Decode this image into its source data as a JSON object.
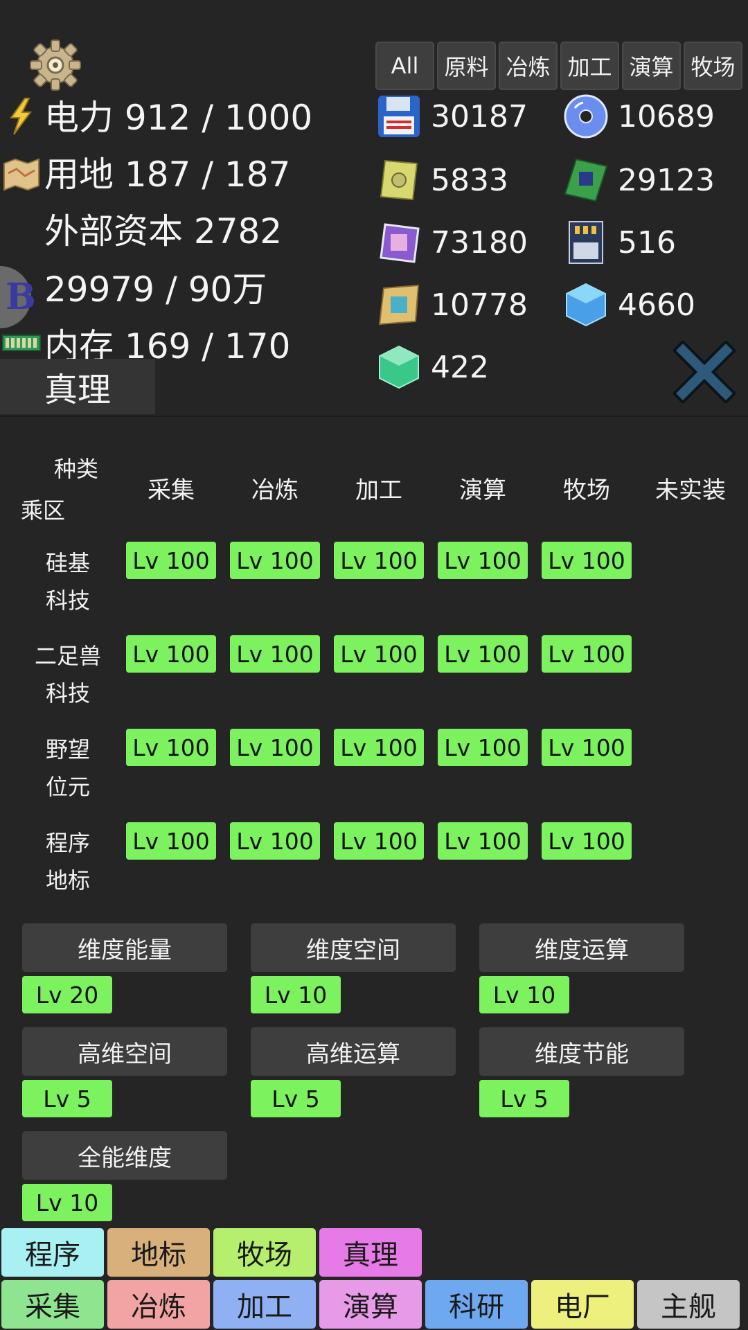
{
  "header": {
    "stats": {
      "power": "电力 912 / 1000",
      "land": "用地 187 / 187",
      "capital": "外部资本 2782",
      "b_currency": "29979 / 90万",
      "memory": "内存 169 / 170"
    },
    "filter_tabs": [
      "All",
      "原料",
      "冶炼",
      "加工",
      "演算",
      "牧场"
    ]
  },
  "resources": [
    "30187",
    "10689",
    "5833",
    "29123",
    "73180",
    "516",
    "10778",
    "4660",
    "422"
  ],
  "active_panel": "真理",
  "grid": {
    "corner_top": "种类",
    "corner_bottom": "乘区",
    "columns": [
      "采集",
      "冶炼",
      "加工",
      "演算",
      "牧场",
      "未实装"
    ],
    "rows": [
      {
        "line1": "硅基",
        "line2": "科技",
        "levels": [
          "Lv 100",
          "Lv 100",
          "Lv 100",
          "Lv 100",
          "Lv 100"
        ]
      },
      {
        "line1": "二足兽",
        "line2": "科技",
        "levels": [
          "Lv 100",
          "Lv 100",
          "Lv 100",
          "Lv 100",
          "Lv 100"
        ]
      },
      {
        "line1": "野望",
        "line2": "位元",
        "levels": [
          "Lv 100",
          "Lv 100",
          "Lv 100",
          "Lv 100",
          "Lv 100"
        ]
      },
      {
        "line1": "程序",
        "line2": "地标",
        "levels": [
          "Lv 100",
          "Lv 100",
          "Lv 100",
          "Lv 100",
          "Lv 100"
        ]
      }
    ]
  },
  "dimensions": [
    {
      "name": "维度能量",
      "level": "Lv 20"
    },
    {
      "name": "维度空间",
      "level": "Lv 10"
    },
    {
      "name": "维度运算",
      "level": "Lv 10"
    },
    {
      "name": "高维空间",
      "level": "Lv 5"
    },
    {
      "name": "高维运算",
      "level": "Lv 5"
    },
    {
      "name": "维度节能",
      "level": "Lv 5"
    },
    {
      "name": "全能维度",
      "level": "Lv 10"
    }
  ],
  "nav_row1": [
    {
      "label": "程序",
      "color": "#a8f0f2"
    },
    {
      "label": "地标",
      "color": "#d7b07c"
    },
    {
      "label": "牧场",
      "color": "#b6ee6e"
    },
    {
      "label": "真理",
      "color": "#e67ae6"
    }
  ],
  "nav_row2": [
    {
      "label": "采集",
      "color": "#8fe58f"
    },
    {
      "label": "冶炼",
      "color": "#f2a3a3"
    },
    {
      "label": "加工",
      "color": "#8fb0f2"
    },
    {
      "label": "演算",
      "color": "#e79ae7"
    },
    {
      "label": "科研",
      "color": "#6ea8f0"
    },
    {
      "label": "电厂",
      "color": "#eef07e"
    },
    {
      "label": "主舰",
      "color": "#c5c5c5"
    }
  ]
}
